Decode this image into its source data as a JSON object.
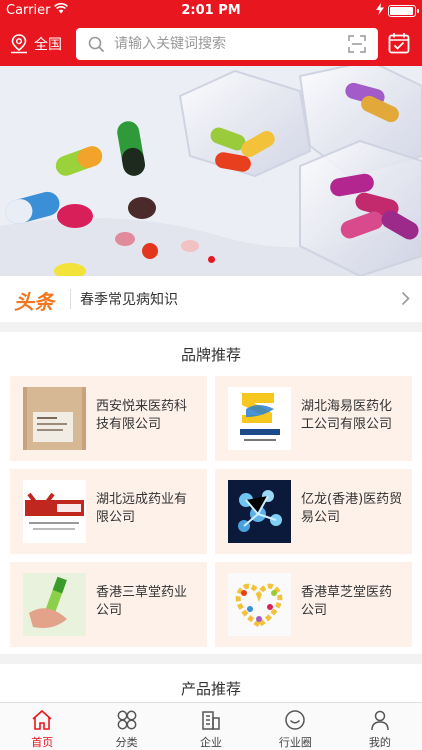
{
  "status_bar": {
    "carrier": "Carrier",
    "time": "2:01 PM"
  },
  "navbar": {
    "location_label": "全国",
    "search_placeholder": "请输入关键词搜索"
  },
  "banner": {
    "page_count": 1,
    "active_page": 1
  },
  "headline": {
    "tag": "头条",
    "text": "春季常见病知识"
  },
  "brands": {
    "title": "品牌推荐",
    "items": [
      {
        "name": "西安悦来医药科技有限公司"
      },
      {
        "name": "湖北海易医药化工公司有限公司"
      },
      {
        "name": "湖北远成药业有限公司"
      },
      {
        "name": "亿龙(香港)医药贸易公司"
      },
      {
        "name": "香港三草堂药业公司"
      },
      {
        "name": "香港草芝堂医药公司"
      }
    ]
  },
  "products": {
    "title": "产品推荐"
  },
  "tabbar": {
    "items": [
      {
        "label": "首页",
        "icon": "home-icon",
        "active": true
      },
      {
        "label": "分类",
        "icon": "category-icon",
        "active": false
      },
      {
        "label": "企业",
        "icon": "building-icon",
        "active": false
      },
      {
        "label": "行业圈",
        "icon": "circle-icon",
        "active": false
      },
      {
        "label": "我的",
        "icon": "person-icon",
        "active": false
      }
    ]
  },
  "colors": {
    "brand_red": "#e8161f",
    "headline_orange": "#f2761f",
    "card_bg": "#fdf1ea"
  }
}
